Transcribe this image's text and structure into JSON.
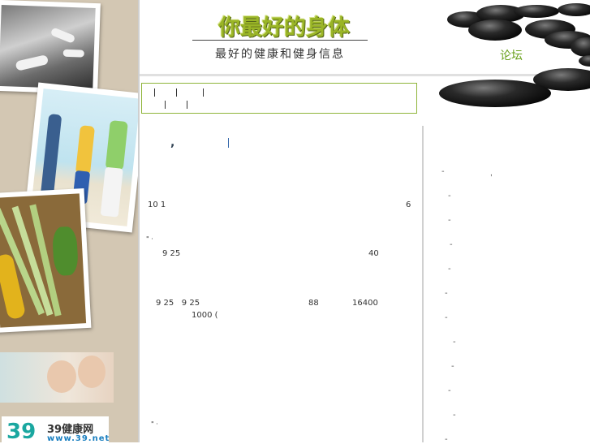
{
  "header": {
    "site_title": "你最好的身体",
    "site_subtitle": "最好的健康和健身信息",
    "forum_label": "论坛"
  },
  "logo": {
    "mark": "39",
    "name": "39健康网",
    "url": "www.39.net"
  },
  "article": {
    "headline_fragment": ",",
    "lines": [
      "10 1",
      "6",
      "\" ·",
      "9 25",
      "40",
      "9 25   9 25",
      "88",
      "16400",
      "1000 (",
      "\" ·"
    ]
  },
  "sidebar": {
    "bullets": [
      "-",
      "-",
      "-",
      "-",
      "-",
      "-",
      "-",
      "-",
      "-",
      "-",
      "-",
      "-",
      "-"
    ]
  },
  "colors": {
    "accent": "#9ab526",
    "forum_link": "#6aa11c",
    "nav_border": "#8fb43a",
    "left_panel": "#d3c7b3"
  }
}
